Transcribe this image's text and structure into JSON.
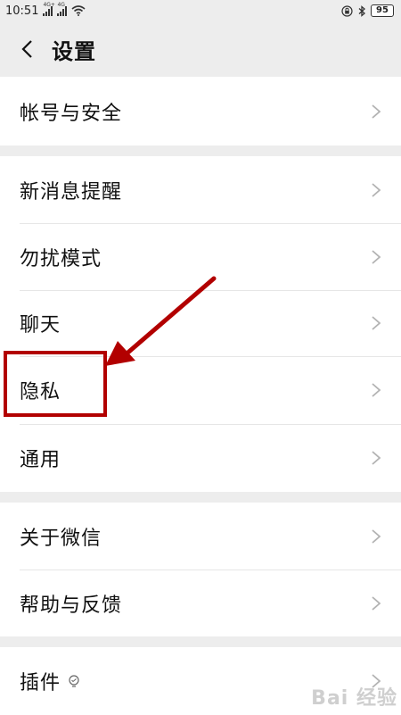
{
  "status": {
    "time": "10:51",
    "sig1_tag": "4G+",
    "sig2_tag": "4G",
    "battery": "95"
  },
  "header": {
    "title": "设置"
  },
  "groups": [
    {
      "items": [
        {
          "label": "帐号与安全"
        }
      ]
    },
    {
      "items": [
        {
          "label": "新消息提醒"
        },
        {
          "label": "勿扰模式"
        },
        {
          "label": "聊天"
        },
        {
          "label": "隐私"
        },
        {
          "label": "通用"
        }
      ]
    },
    {
      "items": [
        {
          "label": "关于微信"
        },
        {
          "label": "帮助与反馈"
        }
      ]
    },
    {
      "items": [
        {
          "label": "插件"
        }
      ]
    }
  ],
  "icons": {
    "back": "chevron-left-icon",
    "row_arrow": "chevron-right-icon",
    "plugin_hint": "bulb-icon",
    "wifi": "wifi-icon",
    "bluetooth": "bluetooth-icon",
    "lock": "lock-rotation-icon"
  },
  "colors": {
    "highlight": "#b20000",
    "background": "#ededed",
    "row": "#ffffff"
  },
  "watermark": "Bai 经验"
}
